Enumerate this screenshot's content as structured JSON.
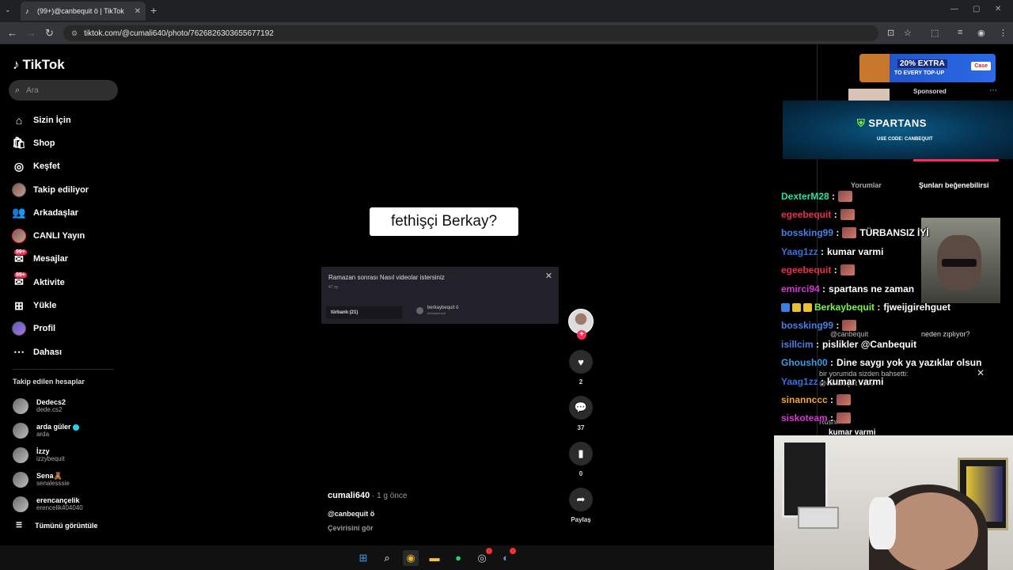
{
  "browser": {
    "tab_title": "(99+)@canbequit ö | TikTok",
    "url": "tiktok.com/@cumali640/photo/7626826303655677192"
  },
  "sidebar": {
    "logo": "TikTok",
    "search_placeholder": "Ara",
    "items": [
      {
        "label": "Sizin İçin",
        "icon": "home-icon"
      },
      {
        "label": "Shop",
        "icon": "shop-icon"
      },
      {
        "label": "Keşfet",
        "icon": "compass-icon"
      },
      {
        "label": "Takip ediliyor",
        "icon": "following-avatar"
      },
      {
        "label": "Arkadaşlar",
        "icon": "friends-icon"
      },
      {
        "label": "CANLI Yayın",
        "icon": "live-icon"
      },
      {
        "label": "Mesajlar",
        "icon": "messages-icon",
        "badge": "99+"
      },
      {
        "label": "Aktivite",
        "icon": "activity-icon",
        "badge": "99+"
      },
      {
        "label": "Yükle",
        "icon": "upload-icon"
      },
      {
        "label": "Profil",
        "icon": "profile-avatar"
      },
      {
        "label": "Dahası",
        "icon": "more-icon"
      }
    ],
    "following_title": "Takip edilen hesaplar",
    "accounts": [
      {
        "name": "Dedecs2",
        "handle": "dede.cs2"
      },
      {
        "name": "arda güler",
        "handle": "arda",
        "verified": true
      },
      {
        "name": "İzzy",
        "handle": "izzybequit"
      },
      {
        "name": "Sena🧸",
        "handle": "senalesssie"
      },
      {
        "name": "erencançelik",
        "handle": "erencelik404040"
      }
    ],
    "see_all": "Tümünü görüntüle"
  },
  "post": {
    "caption_overlay": "fethişçi Berkay?",
    "poll": {
      "question": "Ramazan sonrası Nasıl videolar istersiniz",
      "votes": "47 oy",
      "option": "türbanlı (21)",
      "author_name": "berkaybequit ö",
      "author_handle": "berkaybequit"
    },
    "likes": "2",
    "comments": "37",
    "saves": "0",
    "share_label": "Paylaş",
    "username": "cumali640",
    "time": " · 1 g önce",
    "description": "@canbequit ö",
    "translate": "Çevirisini gör"
  },
  "right": {
    "ad_headline": "20% EXTRA",
    "ad_sub": "TO EVERY TOP-UP",
    "ad_logo": "Case",
    "sponsored": "Sponsored",
    "spartans_logo": "SPARTANS",
    "spartans_code": "USE CODE: CANBEQUIT",
    "tab_comments": "Yorumlar",
    "tab_suggest": "Şunları beğenebilirsi"
  },
  "chat": [
    {
      "user": "DexterM28",
      "color": "#2ee0a0",
      "msg": "",
      "emote": true
    },
    {
      "user": "egeebequit",
      "color": "#e8304a",
      "msg": "",
      "emote": true
    },
    {
      "user": "bossking99",
      "color": "#4a7fe8",
      "msg": "TÜRBANSIZ İYİ",
      "emote": true
    },
    {
      "user": "Yaag1zz",
      "color": "#3a6fd8",
      "msg": "kumar varmi",
      "emote": false
    },
    {
      "user": "egeebequit",
      "color": "#e8304a",
      "msg": "",
      "emote": true
    },
    {
      "user": "emirci94",
      "color": "#d63bd6",
      "msg": "spartans ne zaman",
      "emote": false
    },
    {
      "user": "Berkaybequit",
      "color": "#7cf542",
      "msg": "fjweijgirehguet",
      "emote": false,
      "badges": true
    },
    {
      "user": "bossking99",
      "color": "#4a7fe8",
      "msg": "",
      "emote": true
    },
    {
      "user": "isillcim",
      "color": "#4a7fe8",
      "msg": "pislikler @Canbequit",
      "emote": false
    },
    {
      "user": "Ghoush00",
      "color": "#3a9be8",
      "msg": "Dine saygı yok ya yazıklar olsun",
      "emote": false
    },
    {
      "user": "Yaag1zz",
      "color": "#3a6fd8",
      "msg": "kumar varmi",
      "emote": false
    },
    {
      "user": "sinannccc",
      "color": "#f2a23a",
      "msg": "",
      "emote": true
    },
    {
      "user": "siskoteam",
      "color": "#d63bd6",
      "msg": "",
      "emote": true
    }
  ],
  "overlays": {
    "mention_1": "@canbequit",
    "question": "neden zıplıyor?",
    "mention_notice": "bir yorumda sizden bahsetti:",
    "mention_2": "@canbequit cv9s",
    "name_rushi": "Rushi",
    "last_chat": "kumar varmi"
  },
  "colors": {
    "accent": "#fe2c55",
    "verified": "#20d5ec"
  }
}
